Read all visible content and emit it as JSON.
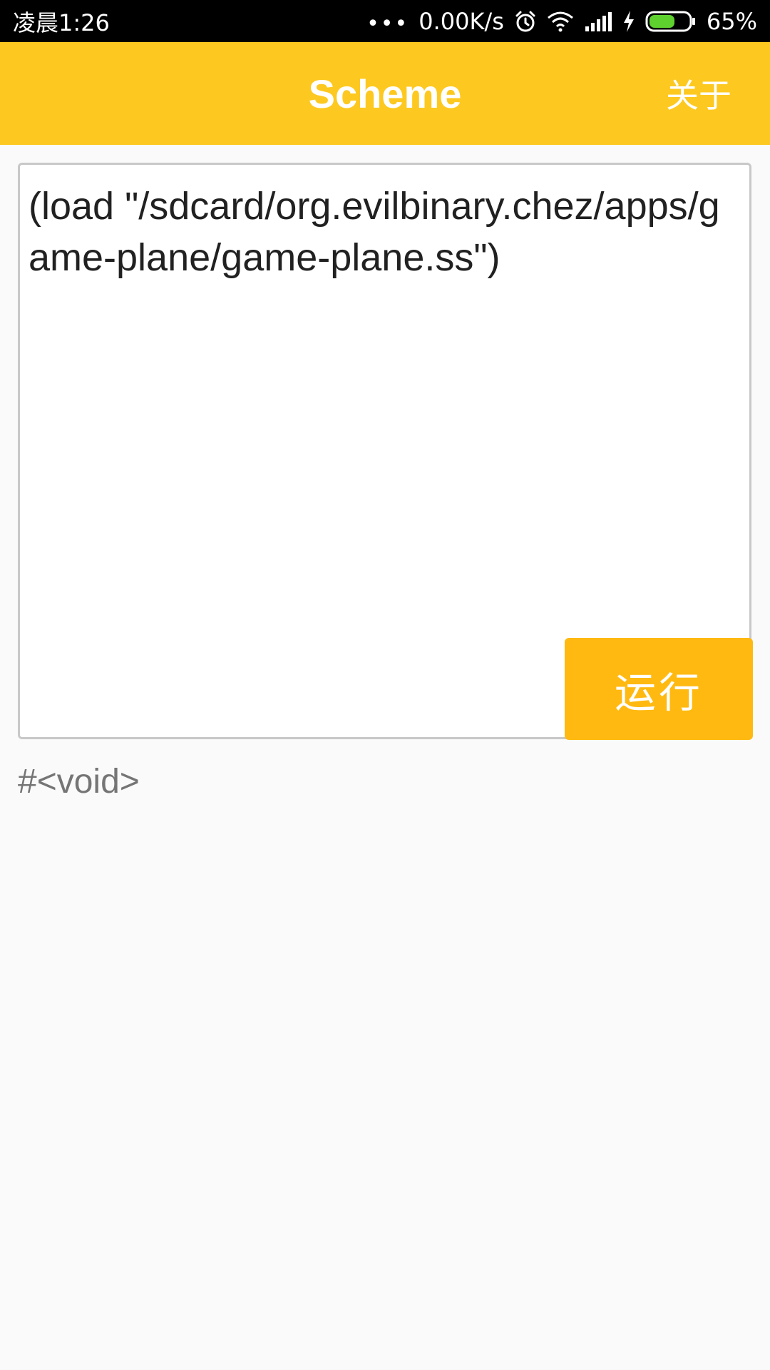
{
  "status_bar": {
    "time": "凌晨1:26",
    "network_speed": "0.00K/s",
    "battery_percent": "65%",
    "battery_level": 0.65,
    "icons": [
      "more-dots-icon",
      "alarm-icon",
      "wifi-icon",
      "signal-icon",
      "charging-icon",
      "battery-icon"
    ]
  },
  "app_bar": {
    "title": "Scheme",
    "about_label": "关于"
  },
  "editor": {
    "code": "(load \"/sdcard/org.evilbinary.chez/apps/game-plane/game-plane.ss\")",
    "run_label": "运行"
  },
  "output": {
    "result": "#<void>"
  },
  "colors": {
    "app_bar": "#fdc920",
    "run_button": "#ffb910",
    "battery_fill": "#5fd12e"
  }
}
